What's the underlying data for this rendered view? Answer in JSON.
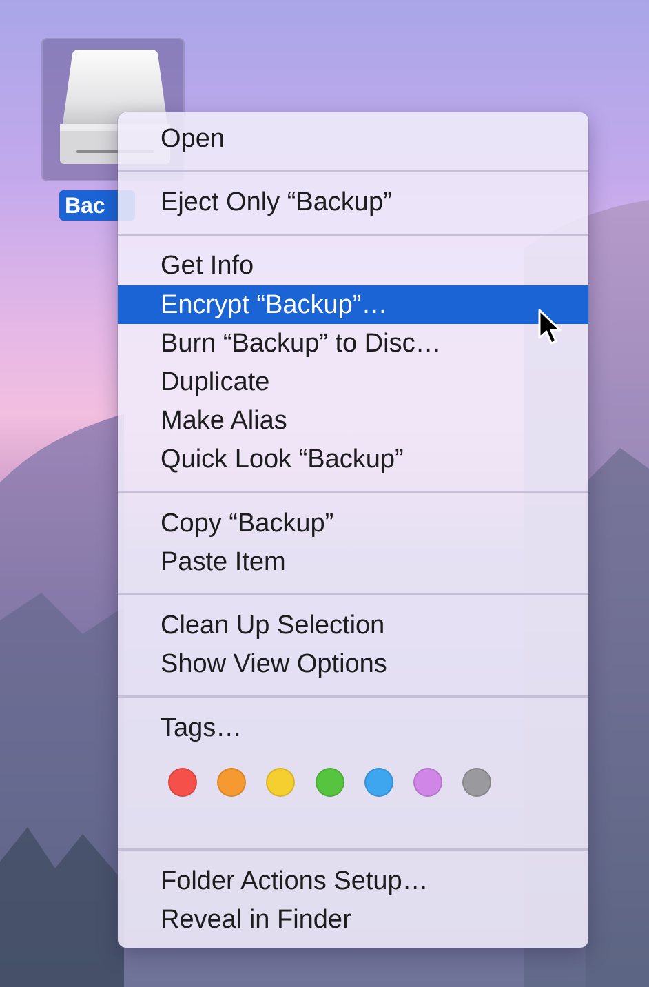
{
  "desktop": {
    "drive_label": "Bac"
  },
  "context_menu": {
    "items": [
      {
        "label": "Open"
      },
      {
        "label": "Eject Only “Backup”"
      },
      {
        "label": "Get Info"
      },
      {
        "label": "Encrypt “Backup”…"
      },
      {
        "label": "Burn “Backup” to Disc…"
      },
      {
        "label": "Duplicate"
      },
      {
        "label": "Make Alias"
      },
      {
        "label": "Quick Look “Backup”"
      },
      {
        "label": "Copy “Backup”"
      },
      {
        "label": "Paste Item"
      },
      {
        "label": "Clean Up Selection"
      },
      {
        "label": "Show View Options"
      },
      {
        "label": "Tags…"
      },
      {
        "label": "Folder Actions Setup…"
      },
      {
        "label": "Reveal in Finder"
      }
    ],
    "highlighted_item": "Encrypt “Backup”…",
    "tag_colors": [
      {
        "name": "red-tag",
        "color": "#f5504a"
      },
      {
        "name": "orange-tag",
        "color": "#f59a30"
      },
      {
        "name": "yellow-tag",
        "color": "#f5ce30"
      },
      {
        "name": "green-tag",
        "color": "#56c43e"
      },
      {
        "name": "blue-tag",
        "color": "#3ea5ef"
      },
      {
        "name": "purple-tag",
        "color": "#cf86e6"
      },
      {
        "name": "gray-tag",
        "color": "#9a9a9e"
      }
    ],
    "highlight_color": "#1a64d6"
  }
}
